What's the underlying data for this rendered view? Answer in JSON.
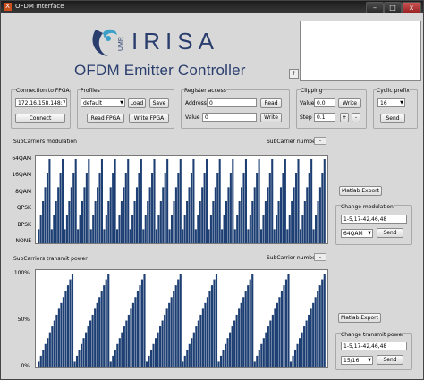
{
  "window": {
    "title": "OFDM Interface",
    "icon_glyph": "X",
    "minimize_glyph": "–",
    "maximize_glyph": "□",
    "close_glyph": "x"
  },
  "header": {
    "logo_text": "IRISA",
    "logo_sub": "UMR",
    "title": "OFDM Emitter Controller",
    "help_label": "?"
  },
  "connection": {
    "group_label": "Connection to FPGA",
    "ip_value": "172.16.158.148:7",
    "connect_label": "Connect"
  },
  "profiles": {
    "group_label": "Profiles",
    "selected": "default",
    "load_label": "Load",
    "save_label": "Save",
    "read_label": "Read FPGA",
    "write_label": "Write FPGA"
  },
  "register": {
    "group_label": "Register access",
    "address_label": "Address",
    "address_value": "0",
    "value_label": "Value",
    "value_value": "0",
    "read_label": "Read",
    "write_label": "Write"
  },
  "clipping": {
    "group_label": "Clipping",
    "value_label": "Value",
    "value_value": "0.0",
    "step_label": "Step",
    "step_value": "0.1",
    "write_label": "Write",
    "plus_label": "+",
    "minus_label": "-"
  },
  "cyclic": {
    "group_label": "Cyclic prefix",
    "selected": "16",
    "send_label": "Send"
  },
  "modulation": {
    "section_label": "SubCarriers modulation",
    "subcarrier_label": "SubCarrier number",
    "subcarrier_value": "-",
    "yticks": [
      "64QAM",
      "16QAM",
      "8QAM",
      "QPSK",
      "BPSK",
      "NONE"
    ],
    "matlab_label": "Matlab Export",
    "change_group_label": "Change modulation",
    "range_value": "1-5,17-42,46,48",
    "selected": "64QAM",
    "send_label": "Send"
  },
  "power": {
    "section_label": "SubCarriers transmit power",
    "subcarrier_label": "SubCarrier number",
    "subcarrier_value": "-",
    "yticks": [
      "100%",
      "50%",
      "0%"
    ],
    "matlab_label": "Matlab Export",
    "change_group_label": "Change transmit power",
    "range_value": "1-5,17-42,46,48",
    "selected": "15/16",
    "send_label": "Send"
  },
  "colors": {
    "bar": "#1d3f73",
    "title": "#2a3e6e",
    "accent": "#3aa0c8"
  },
  "chart_data": [
    {
      "type": "bar",
      "title": "SubCarriers modulation",
      "yticks": [
        "NONE",
        "BPSK",
        "QPSK",
        "8QAM",
        "16QAM",
        "64QAM"
      ],
      "pattern": "sawtooth",
      "teeth": 22,
      "bars_per_tooth": 6
    },
    {
      "type": "bar",
      "title": "SubCarriers transmit power",
      "ylim": [
        0,
        100
      ],
      "yticks": [
        "0%",
        "50%",
        "100%"
      ],
      "pattern": "sawtooth",
      "teeth": 8,
      "bars_per_tooth": 16
    }
  ]
}
